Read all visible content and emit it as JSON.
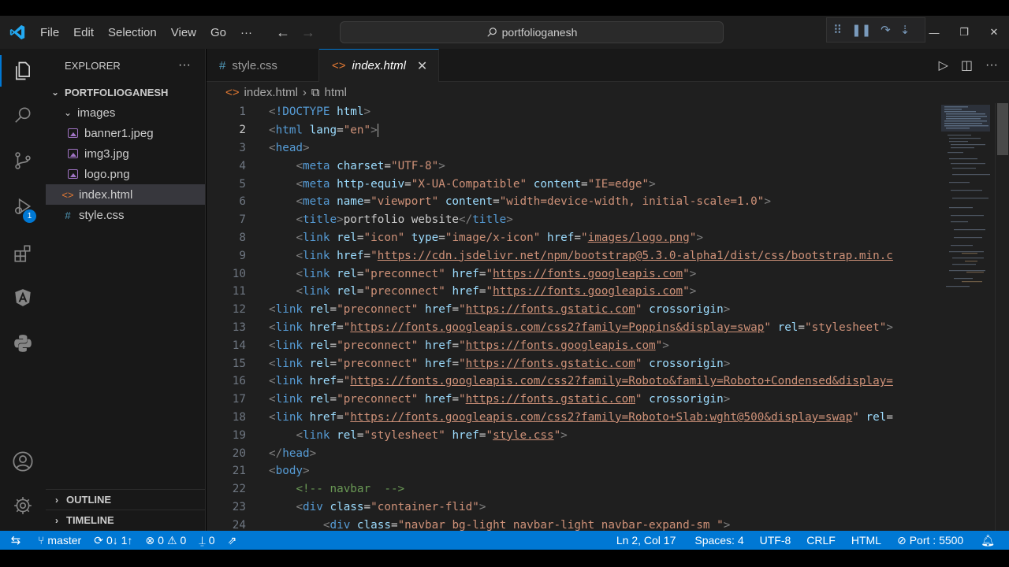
{
  "titlebar": {
    "menu": [
      "File",
      "Edit",
      "Selection",
      "View",
      "Go",
      "···"
    ],
    "search": "portfolioganesh"
  },
  "sidebar": {
    "title": "EXPLORER",
    "more": "···",
    "root": "PORTFOLIOGANESH",
    "folder": "images",
    "images": [
      "banner1.jpeg",
      "img3.jpg",
      "logo.png"
    ],
    "files": [
      {
        "name": "index.html",
        "icon": "<>"
      },
      {
        "name": "style.css",
        "icon": "#"
      }
    ],
    "outline": "OUTLINE",
    "timeline": "TIMELINE"
  },
  "activity": {
    "debug_badge": "1"
  },
  "tabs": [
    {
      "icon": "#",
      "label": "style.css"
    },
    {
      "icon": "<>",
      "label": "index.html",
      "close": "✕"
    }
  ],
  "breadcrumb": {
    "file": "index.html",
    "symbol": "html"
  },
  "editor": {
    "current_line": 2,
    "lines": [
      {
        "n": "1",
        "t": [
          [
            "p",
            "<"
          ],
          [
            "t",
            "!DOCTYPE"
          ],
          [
            "x",
            " "
          ],
          [
            "a",
            "html"
          ],
          [
            "p",
            ">"
          ]
        ]
      },
      {
        "n": "2",
        "t": [
          [
            "p",
            "<"
          ],
          [
            "t",
            "html"
          ],
          [
            "x",
            " "
          ],
          [
            "a",
            "lang"
          ],
          [
            "x",
            "="
          ],
          [
            "s",
            "\"en\""
          ],
          [
            "p",
            ">"
          ]
        ]
      },
      {
        "n": "3",
        "t": [
          [
            "p",
            "<"
          ],
          [
            "t",
            "head"
          ],
          [
            "p",
            ">"
          ]
        ]
      },
      {
        "n": "4",
        "t": [
          [
            "x",
            "    "
          ],
          [
            "p",
            "<"
          ],
          [
            "t",
            "meta"
          ],
          [
            "x",
            " "
          ],
          [
            "a",
            "charset"
          ],
          [
            "x",
            "="
          ],
          [
            "s",
            "\"UTF-8\""
          ],
          [
            "p",
            ">"
          ]
        ]
      },
      {
        "n": "5",
        "t": [
          [
            "x",
            "    "
          ],
          [
            "p",
            "<"
          ],
          [
            "t",
            "meta"
          ],
          [
            "x",
            " "
          ],
          [
            "a",
            "http-equiv"
          ],
          [
            "x",
            "="
          ],
          [
            "s",
            "\"X-UA-Compatible\""
          ],
          [
            "x",
            " "
          ],
          [
            "a",
            "content"
          ],
          [
            "x",
            "="
          ],
          [
            "s",
            "\"IE=edge\""
          ],
          [
            "p",
            ">"
          ]
        ]
      },
      {
        "n": "6",
        "t": [
          [
            "x",
            "    "
          ],
          [
            "p",
            "<"
          ],
          [
            "t",
            "meta"
          ],
          [
            "x",
            " "
          ],
          [
            "a",
            "name"
          ],
          [
            "x",
            "="
          ],
          [
            "s",
            "\"viewport\""
          ],
          [
            "x",
            " "
          ],
          [
            "a",
            "content"
          ],
          [
            "x",
            "="
          ],
          [
            "s",
            "\"width=device-width, initial-scale=1.0\""
          ],
          [
            "p",
            ">"
          ]
        ]
      },
      {
        "n": "7",
        "t": [
          [
            "x",
            "    "
          ],
          [
            "p",
            "<"
          ],
          [
            "t",
            "title"
          ],
          [
            "p",
            ">"
          ],
          [
            "x",
            "portfolio website"
          ],
          [
            "p",
            "</"
          ],
          [
            "t",
            "title"
          ],
          [
            "p",
            ">"
          ]
        ]
      },
      {
        "n": "8",
        "t": [
          [
            "x",
            "    "
          ],
          [
            "p",
            "<"
          ],
          [
            "t",
            "link"
          ],
          [
            "x",
            " "
          ],
          [
            "a",
            "rel"
          ],
          [
            "x",
            "="
          ],
          [
            "s",
            "\"icon\""
          ],
          [
            "x",
            " "
          ],
          [
            "a",
            "type"
          ],
          [
            "x",
            "="
          ],
          [
            "s",
            "\"image/x-icon\""
          ],
          [
            "x",
            " "
          ],
          [
            "a",
            "href"
          ],
          [
            "x",
            "="
          ],
          [
            "s",
            "\""
          ],
          [
            "u",
            "images/logo.png"
          ],
          [
            "s",
            "\""
          ],
          [
            "p",
            ">"
          ]
        ]
      },
      {
        "n": "9",
        "t": [
          [
            "x",
            "    "
          ],
          [
            "p",
            "<"
          ],
          [
            "t",
            "link"
          ],
          [
            "x",
            " "
          ],
          [
            "a",
            "href"
          ],
          [
            "x",
            "="
          ],
          [
            "s",
            "\""
          ],
          [
            "u",
            "https://cdn.jsdelivr.net/npm/bootstrap@5.3.0-alpha1/dist/css/bootstrap.min.c"
          ]
        ]
      },
      {
        "n": "10",
        "t": [
          [
            "x",
            "    "
          ],
          [
            "p",
            "<"
          ],
          [
            "t",
            "link"
          ],
          [
            "x",
            " "
          ],
          [
            "a",
            "rel"
          ],
          [
            "x",
            "="
          ],
          [
            "s",
            "\"preconnect\""
          ],
          [
            "x",
            " "
          ],
          [
            "a",
            "href"
          ],
          [
            "x",
            "="
          ],
          [
            "s",
            "\""
          ],
          [
            "u",
            "https://fonts.googleapis.com"
          ],
          [
            "s",
            "\""
          ],
          [
            "p",
            ">"
          ]
        ]
      },
      {
        "n": "11",
        "t": [
          [
            "x",
            "    "
          ],
          [
            "p",
            "<"
          ],
          [
            "t",
            "link"
          ],
          [
            "x",
            " "
          ],
          [
            "a",
            "rel"
          ],
          [
            "x",
            "="
          ],
          [
            "s",
            "\"preconnect\""
          ],
          [
            "x",
            " "
          ],
          [
            "a",
            "href"
          ],
          [
            "x",
            "="
          ],
          [
            "s",
            "\""
          ],
          [
            "u",
            "https://fonts.googleapis.com"
          ],
          [
            "s",
            "\""
          ],
          [
            "p",
            ">"
          ]
        ]
      },
      {
        "n": "12",
        "t": [
          [
            "p",
            "<"
          ],
          [
            "t",
            "link"
          ],
          [
            "x",
            " "
          ],
          [
            "a",
            "rel"
          ],
          [
            "x",
            "="
          ],
          [
            "s",
            "\"preconnect\""
          ],
          [
            "x",
            " "
          ],
          [
            "a",
            "href"
          ],
          [
            "x",
            "="
          ],
          [
            "s",
            "\""
          ],
          [
            "u",
            "https://fonts.gstatic.com"
          ],
          [
            "s",
            "\""
          ],
          [
            "x",
            " "
          ],
          [
            "a",
            "crossorigin"
          ],
          [
            "p",
            ">"
          ]
        ]
      },
      {
        "n": "13",
        "t": [
          [
            "p",
            "<"
          ],
          [
            "t",
            "link"
          ],
          [
            "x",
            " "
          ],
          [
            "a",
            "href"
          ],
          [
            "x",
            "="
          ],
          [
            "s",
            "\""
          ],
          [
            "u",
            "https://fonts.googleapis.com/css2?family=Poppins&display=swap"
          ],
          [
            "s",
            "\""
          ],
          [
            "x",
            " "
          ],
          [
            "a",
            "rel"
          ],
          [
            "x",
            "="
          ],
          [
            "s",
            "\"stylesheet\""
          ],
          [
            "p",
            ">"
          ]
        ]
      },
      {
        "n": "14",
        "t": [
          [
            "p",
            "<"
          ],
          [
            "t",
            "link"
          ],
          [
            "x",
            " "
          ],
          [
            "a",
            "rel"
          ],
          [
            "x",
            "="
          ],
          [
            "s",
            "\"preconnect\""
          ],
          [
            "x",
            " "
          ],
          [
            "a",
            "href"
          ],
          [
            "x",
            "="
          ],
          [
            "s",
            "\""
          ],
          [
            "u",
            "https://fonts.googleapis.com"
          ],
          [
            "s",
            "\""
          ],
          [
            "p",
            ">"
          ]
        ]
      },
      {
        "n": "15",
        "t": [
          [
            "p",
            "<"
          ],
          [
            "t",
            "link"
          ],
          [
            "x",
            " "
          ],
          [
            "a",
            "rel"
          ],
          [
            "x",
            "="
          ],
          [
            "s",
            "\"preconnect\""
          ],
          [
            "x",
            " "
          ],
          [
            "a",
            "href"
          ],
          [
            "x",
            "="
          ],
          [
            "s",
            "\""
          ],
          [
            "u",
            "https://fonts.gstatic.com"
          ],
          [
            "s",
            "\""
          ],
          [
            "x",
            " "
          ],
          [
            "a",
            "crossorigin"
          ],
          [
            "p",
            ">"
          ]
        ]
      },
      {
        "n": "16",
        "t": [
          [
            "p",
            "<"
          ],
          [
            "t",
            "link"
          ],
          [
            "x",
            " "
          ],
          [
            "a",
            "href"
          ],
          [
            "x",
            "="
          ],
          [
            "s",
            "\""
          ],
          [
            "u",
            "https://fonts.googleapis.com/css2?family=Roboto&family=Roboto+Condensed&display="
          ]
        ]
      },
      {
        "n": "17",
        "t": [
          [
            "p",
            "<"
          ],
          [
            "t",
            "link"
          ],
          [
            "x",
            " "
          ],
          [
            "a",
            "rel"
          ],
          [
            "x",
            "="
          ],
          [
            "s",
            "\"preconnect\""
          ],
          [
            "x",
            " "
          ],
          [
            "a",
            "href"
          ],
          [
            "x",
            "="
          ],
          [
            "s",
            "\""
          ],
          [
            "u",
            "https://fonts.gstatic.com"
          ],
          [
            "s",
            "\""
          ],
          [
            "x",
            " "
          ],
          [
            "a",
            "crossorigin"
          ],
          [
            "p",
            ">"
          ]
        ]
      },
      {
        "n": "18",
        "t": [
          [
            "p",
            "<"
          ],
          [
            "t",
            "link"
          ],
          [
            "x",
            " "
          ],
          [
            "a",
            "href"
          ],
          [
            "x",
            "="
          ],
          [
            "s",
            "\""
          ],
          [
            "u",
            "https://fonts.googleapis.com/css2?family=Roboto+Slab:wght@500&display=swap"
          ],
          [
            "s",
            "\""
          ],
          [
            "x",
            " "
          ],
          [
            "a",
            "rel"
          ],
          [
            "x",
            "="
          ]
        ]
      },
      {
        "n": "19",
        "t": [
          [
            "x",
            "    "
          ],
          [
            "p",
            "<"
          ],
          [
            "t",
            "link"
          ],
          [
            "x",
            " "
          ],
          [
            "a",
            "rel"
          ],
          [
            "x",
            "="
          ],
          [
            "s",
            "\"stylesheet\""
          ],
          [
            "x",
            " "
          ],
          [
            "a",
            "href"
          ],
          [
            "x",
            "="
          ],
          [
            "s",
            "\""
          ],
          [
            "u",
            "style.css"
          ],
          [
            "s",
            "\""
          ],
          [
            "p",
            ">"
          ]
        ]
      },
      {
        "n": "20",
        "t": [
          [
            "p",
            "</"
          ],
          [
            "t",
            "head"
          ],
          [
            "p",
            ">"
          ]
        ]
      },
      {
        "n": "21",
        "t": [
          [
            "p",
            "<"
          ],
          [
            "t",
            "body"
          ],
          [
            "p",
            ">"
          ]
        ]
      },
      {
        "n": "22",
        "t": [
          [
            "x",
            "    "
          ],
          [
            "c",
            "<!-- navbar  -->"
          ]
        ]
      },
      {
        "n": "23",
        "t": [
          [
            "x",
            "    "
          ],
          [
            "p",
            "<"
          ],
          [
            "t",
            "div"
          ],
          [
            "x",
            " "
          ],
          [
            "a",
            "class"
          ],
          [
            "x",
            "="
          ],
          [
            "s",
            "\"container-flid\""
          ],
          [
            "p",
            ">"
          ]
        ]
      },
      {
        "n": "24",
        "t": [
          [
            "x",
            "        "
          ],
          [
            "p",
            "<"
          ],
          [
            "t",
            "div"
          ],
          [
            "x",
            " "
          ],
          [
            "a",
            "class"
          ],
          [
            "x",
            "="
          ],
          [
            "s",
            "\"navbar bg-light navbar-light navbar-expand-sm \""
          ],
          [
            "p",
            ">"
          ]
        ]
      }
    ]
  },
  "statusbar": {
    "branch": "master",
    "sync": "0↓ 1↑",
    "errors": "0",
    "warnings": "0",
    "ports": "0",
    "position": "Ln 2, Col 17",
    "spaces": "Spaces: 4",
    "encoding": "UTF-8",
    "eol": "CRLF",
    "language": "HTML",
    "live_server": "Port : 5500"
  },
  "colors": {
    "accent": "#0078d4",
    "tag": "#569cd6",
    "attribute": "#9cdcfe",
    "string": "#ce9178",
    "comment": "#6a9955"
  }
}
